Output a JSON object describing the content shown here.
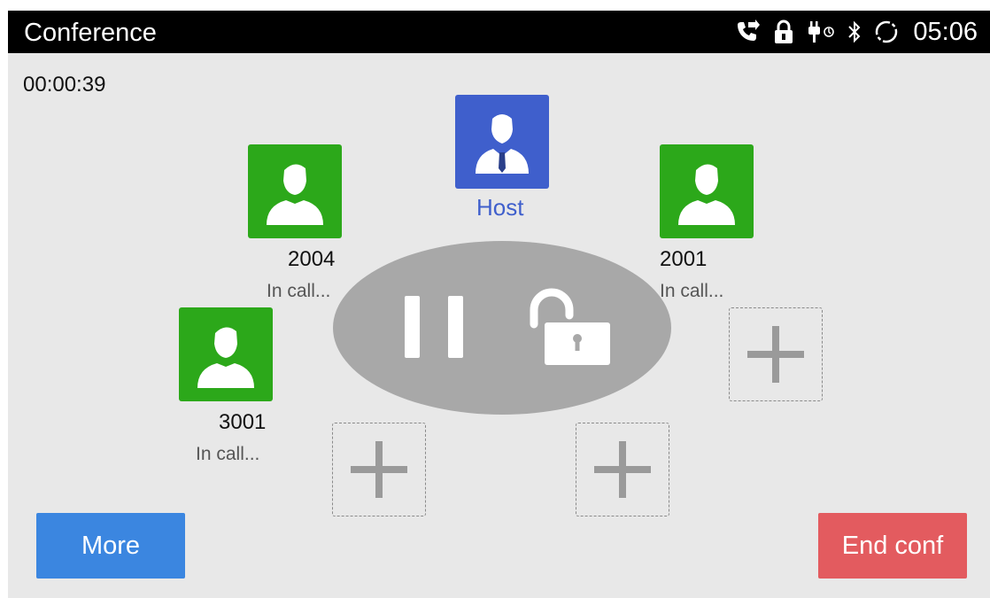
{
  "statusbar": {
    "title": "Conference",
    "time": "05:06",
    "icons": [
      "call-forward-icon",
      "lock-icon",
      "power-plug-icon",
      "bluetooth-icon",
      "sync-icon"
    ]
  },
  "timer": "00:00:39",
  "host": {
    "label": "Host"
  },
  "participants": [
    {
      "number": "2004",
      "status": "In call..."
    },
    {
      "number": "2001",
      "status": "In call..."
    },
    {
      "number": "3001",
      "status": "In call..."
    }
  ],
  "controls": {
    "pause": "pause-icon",
    "lock": "unlocked-icon"
  },
  "buttons": {
    "more": "More",
    "end_conf": "End conf"
  },
  "colors": {
    "participant": "#2ca81a",
    "host": "#3f5fcc",
    "more_button": "#3b86e0",
    "end_button": "#e35b5f"
  }
}
